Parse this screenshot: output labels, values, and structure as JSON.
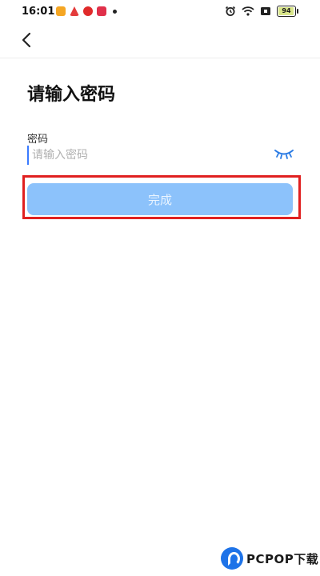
{
  "status_bar": {
    "time": "16:01",
    "battery": "94",
    "battery_level": 0.94,
    "icons": [
      "app-icon-1",
      "app-icon-2",
      "app-icon-3",
      "app-icon-4",
      "alarm-icon",
      "wifi-icon",
      "sim-icon",
      "battery-icon"
    ],
    "app_colors": [
      "#f5a623",
      "#e33b3b",
      "#e02a2a",
      "#e0304a"
    ]
  },
  "nav": {
    "back_icon": "chevron-left-icon"
  },
  "page": {
    "title": "请输入密码"
  },
  "password": {
    "label": "密码",
    "placeholder": "请输入密码",
    "value": "",
    "toggle_icon": "eye-closed-icon"
  },
  "actions": {
    "done_label": "完成"
  },
  "colors": {
    "accent": "#3a7bff",
    "button_disabled": "#8cc2fb",
    "highlight": "#e02020",
    "eye": "#2a7be4"
  },
  "watermark": {
    "text": "PCPOP下载"
  }
}
